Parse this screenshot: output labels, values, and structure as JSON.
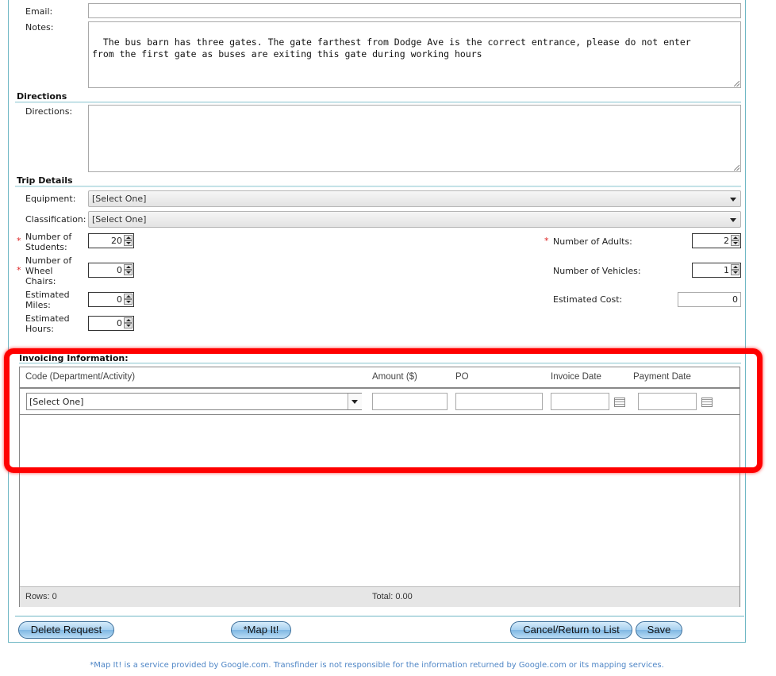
{
  "contact": {
    "email_label": "Email:",
    "email_value": "",
    "notes_label": "Notes:",
    "notes_value": "The bus barn has three gates. The gate farthest from Dodge Ave is the correct entrance, please do not enter\nfrom the first gate as buses are exiting this gate during working hours"
  },
  "directions": {
    "section_title": "Directions",
    "label": "Directions:",
    "value": ""
  },
  "trip": {
    "section_title": "Trip Details",
    "equipment_label": "Equipment:",
    "equipment_value": "[Select One]",
    "classification_label": "Classification:",
    "classification_value": "[Select One]",
    "students_label_1": "Number of",
    "students_label_2": "Students:",
    "students_value": "20",
    "wheelchairs_label_1": "Number of",
    "wheelchairs_label_2": "Wheel",
    "wheelchairs_label_3": "Chairs:",
    "wheelchairs_value": "0",
    "miles_label_1": "Estimated",
    "miles_label_2": "Miles:",
    "miles_value": "0",
    "hours_label_1": "Estimated",
    "hours_label_2": "Hours:",
    "hours_value": "0",
    "adults_label": "Number of Adults:",
    "adults_value": "2",
    "vehicles_label": "Number of Vehicles:",
    "vehicles_value": "1",
    "cost_label": "Estimated Cost:",
    "cost_value": "0",
    "required_marker": "*"
  },
  "invoicing": {
    "section_title": "Invoicing Information:",
    "columns": {
      "code": "Code (Department/Activity)",
      "amount": "Amount ($)",
      "po": "PO",
      "invoice_date": "Invoice Date",
      "payment_date": "Payment Date"
    },
    "row": {
      "code_value": "[Select One]",
      "amount_value": "",
      "po_value": "",
      "invoice_date_value": "",
      "payment_date_value": ""
    },
    "footer_rows": "Rows: 0",
    "footer_total": "Total: 0.00"
  },
  "buttons": {
    "delete": "Delete Request",
    "map": "*Map It!",
    "cancel": "Cancel/Return to List",
    "save": "Save"
  },
  "footnote": "*Map It! is a service provided by Google.com.  Transfinder is not responsible for the information returned by Google.com or its mapping services.",
  "colors": {
    "frame": "#6fb7c4",
    "highlight": "#ff0000",
    "button": "#a7d0f0",
    "footnote": "#4f86c6"
  }
}
